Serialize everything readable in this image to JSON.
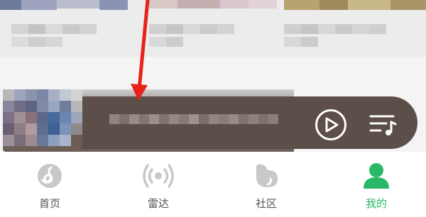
{
  "colors": {
    "accent": "#2bb768",
    "inactive_label": "#555555",
    "inactive_icon": "#c8c8c8",
    "player_bg": "#5c4e48",
    "arrow": "#e8221a"
  },
  "mini_player": {
    "play_icon": "play-icon",
    "playlist_icon": "playlist-icon"
  },
  "tabs": [
    {
      "label": "首页",
      "icon": "home-icon",
      "active": false
    },
    {
      "label": "雷达",
      "icon": "radar-icon",
      "active": false
    },
    {
      "label": "社区",
      "icon": "community-icon",
      "active": false
    },
    {
      "label": "我的",
      "icon": "profile-icon",
      "active": true
    }
  ]
}
